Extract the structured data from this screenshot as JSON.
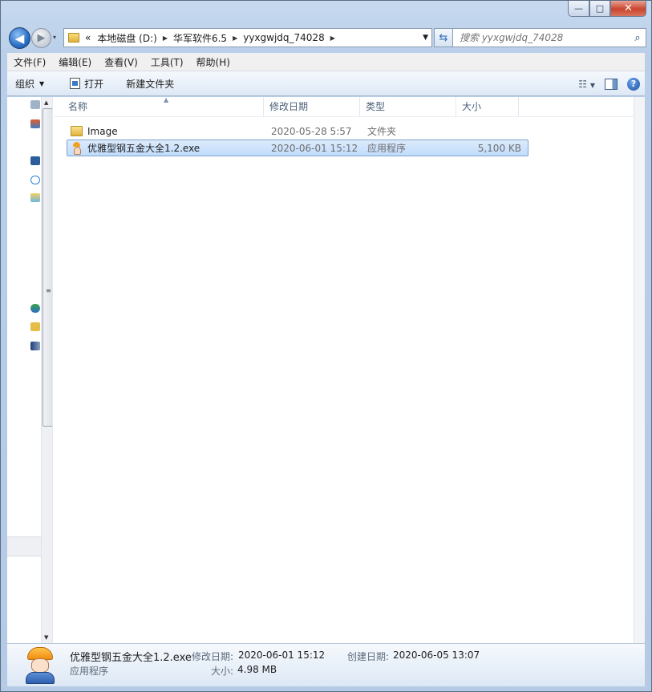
{
  "window": {
    "controls": {
      "minimize": "—",
      "maximize": "□",
      "close": "✕"
    }
  },
  "nav": {
    "back_icon": "◀",
    "forward_icon": "▶",
    "history_icon": "▾",
    "breadcrumb": [
      "本地磁盘 (D:)",
      "华军软件6.5",
      "yyxgwjdq_74028"
    ],
    "overflow": "«",
    "search_placeholder": "搜索 yyxgwjdq_74028"
  },
  "menubar": [
    "文件(F)",
    "编辑(E)",
    "查看(V)",
    "工具(T)",
    "帮助(H)"
  ],
  "commandbar": {
    "organize": "组织",
    "open": "打开",
    "new_folder": "新建文件夹"
  },
  "columns": {
    "name": "名称",
    "date": "修改日期",
    "type": "类型",
    "size": "大小"
  },
  "files": [
    {
      "name": "Image",
      "date": "2020-05-28 5:57",
      "type": "文件夹",
      "size": "",
      "icon": "folder-icon",
      "selected": false
    },
    {
      "name": "优雅型钢五金大全1.2.exe",
      "date": "2020-06-01 15:12",
      "type": "应用程序",
      "size": "5,100 KB",
      "icon": "exe-icon",
      "selected": true
    }
  ],
  "details": {
    "name": "优雅型钢五金大全1.2.exe",
    "type": "应用程序",
    "modified_label": "修改日期:",
    "modified": "2020-06-01 15:12",
    "created_label": "创建日期:",
    "created": "2020-06-05 13:07",
    "size_label": "大小:",
    "size": "4.98 MB"
  },
  "colors": {
    "selection": "#c1dcfc",
    "selection_border": "#7da2ce",
    "chrome": "#b9cfe9"
  }
}
